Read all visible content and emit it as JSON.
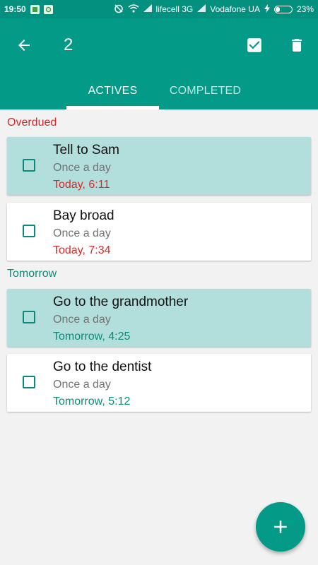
{
  "status_bar": {
    "time": "19:50",
    "carrier1": "lifecell 3G",
    "carrier2": "Vodafone UA",
    "battery": "23%"
  },
  "app_bar": {
    "selected_count": "2",
    "back_icon": "arrow-left-icon",
    "check_icon": "check-box-icon",
    "delete_icon": "trash-icon"
  },
  "tabs": [
    {
      "label": "ACTIVES",
      "active": true
    },
    {
      "label": "COMPLETED",
      "active": false
    }
  ],
  "colors": {
    "primary": "#039b88",
    "overdue": "#e02626",
    "tomorrow": "#0b8a7a",
    "selected_card": "#b2dfdb"
  },
  "sections": [
    {
      "label": "Overdued",
      "items": [
        {
          "title": "Tell to Sam",
          "repeat": "Once a day",
          "when": "Today, 6:11",
          "selected": true
        },
        {
          "title": "Bay broad",
          "repeat": "Once a day",
          "when": "Today, 7:34",
          "selected": false
        }
      ]
    },
    {
      "label": "Tomorrow",
      "items": [
        {
          "title": "Go to the grandmother",
          "repeat": "Once a day",
          "when": "Tomorrow, 4:25",
          "selected": true
        },
        {
          "title": "Go to the dentist",
          "repeat": "Once a day",
          "when": "Tomorrow, 5:12",
          "selected": false
        }
      ]
    }
  ],
  "fab": {
    "icon": "plus-icon"
  }
}
